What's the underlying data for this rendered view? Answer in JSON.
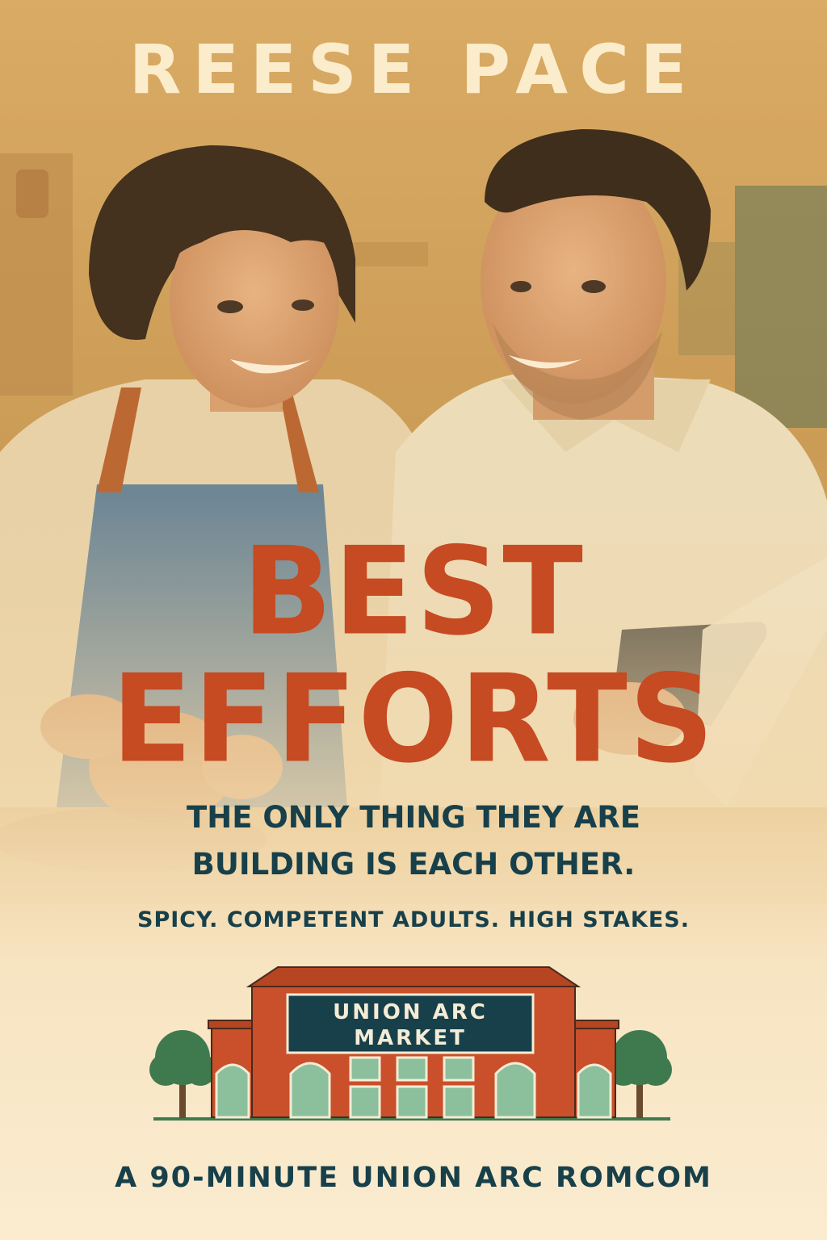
{
  "cover": {
    "author": "REESE PACE",
    "title_line_1": "BEST",
    "title_line_2": "EFFORTS",
    "tagline_line_1": "THE ONLY THING THEY ARE",
    "tagline_line_2": "BUILDING IS EACH OTHER.",
    "subtitle": "SPICY. COMPETENT ADULTS. HIGH STAKES.",
    "logo_sign_line_1": "UNION ARC",
    "logo_sign_line_2": "MARKET",
    "footer": "A 90-MINUTE UNION ARC ROMCOM"
  },
  "colors": {
    "author": "#fbeccb",
    "title": "#c64a22",
    "text_dark": "#17404a",
    "building": "#c9502a",
    "sign": "#17404a",
    "tree": "#3f7a4f",
    "window": "#8cbf9c"
  }
}
